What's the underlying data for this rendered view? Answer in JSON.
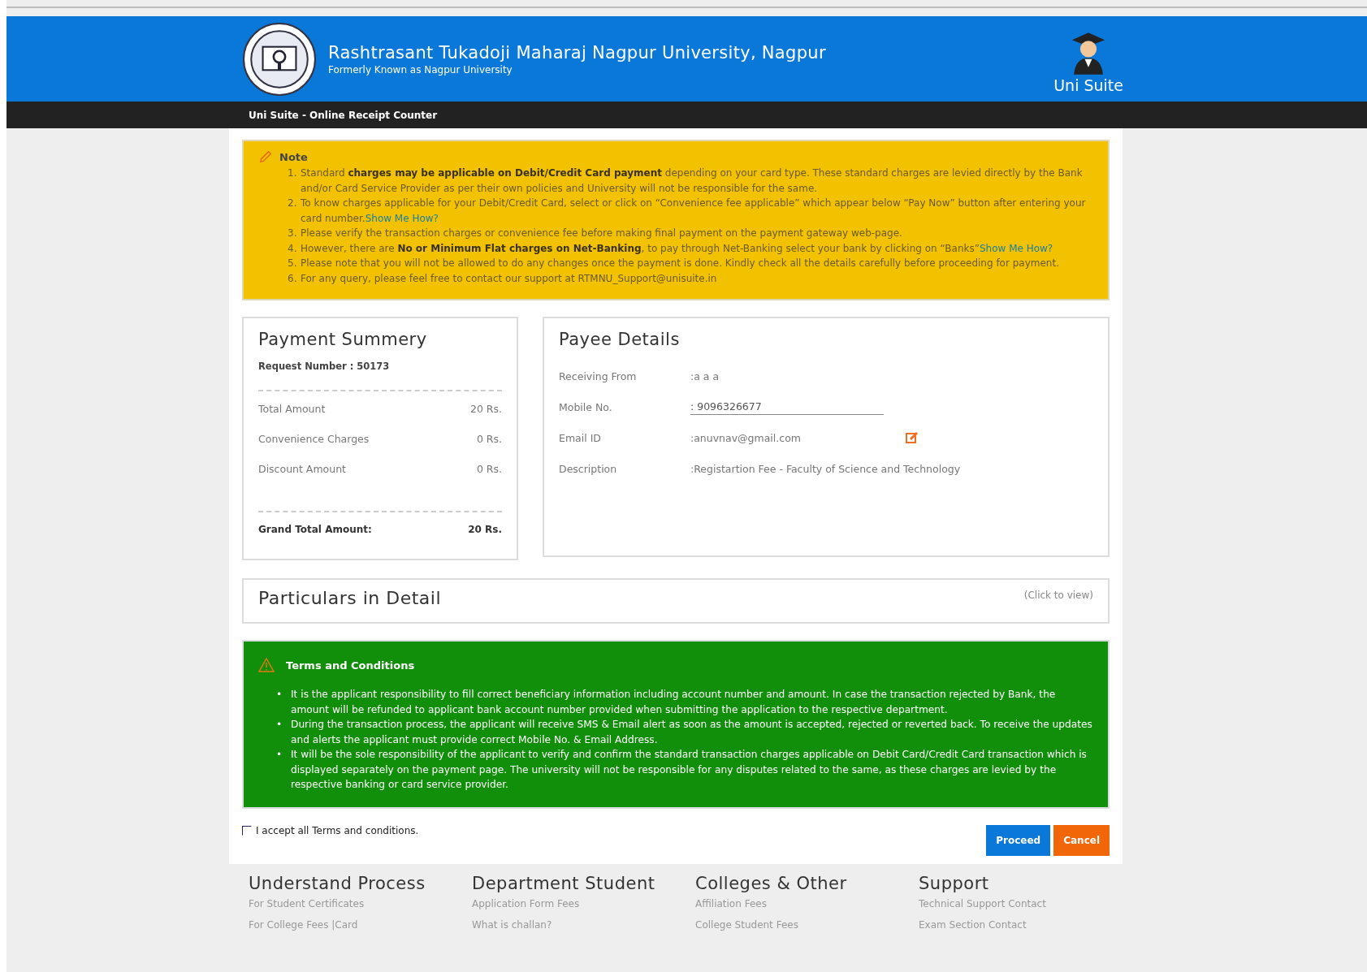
{
  "header": {
    "title": "Rashtrasant Tukadoji Maharaj Nagpur University, Nagpur",
    "subtitle": "Formerly Known as Nagpur University",
    "brand": "Uni Suite"
  },
  "breadcrumb": "Uni Suite - Online Receipt Counter",
  "note": {
    "title": "Note",
    "items": [
      {
        "number": "1.",
        "text": "Standard **charges may be applicable on Debit/Credit Card payment** depending on your card type. These standard charges are levied directly by the Bank and/or Card Service Provider as per their own policies and University will not be responsible for the same."
      },
      {
        "number": "2.",
        "text": "To know charges applicable for your Debit/Credit Card, select or click on “Convenience fee applicable” which appear below “Pay Now” button after entering your card number.",
        "link": "Show Me How?"
      },
      {
        "number": "3.",
        "text": "Please verify the transaction charges or convenience fee before making final payment on the payment gateway web-page."
      },
      {
        "number": "4.",
        "text": "However, there are **No or Minimum Flat charges on Net-Banking**, to pay through Net-Banking select your bank by clicking on “Banks”",
        "link": "Show Me How?"
      },
      {
        "number": "5.",
        "text": "Please note that you will not be allowed to do any changes once the payment is done. Kindly check all the details carefully before proceeding for payment."
      },
      {
        "number": "6.",
        "text": "For any query, please feel free to contact our support at RTMNU_Support@unisuite.in"
      }
    ]
  },
  "payment_summary": {
    "title": "Payment Summery",
    "request_number": "Request Number : 50173",
    "rows": [
      {
        "label": "Total Amount",
        "value": "20 Rs."
      },
      {
        "label": "Convenience Charges",
        "value": "0 Rs."
      },
      {
        "label": "Discount Amount",
        "value": "0 Rs."
      }
    ],
    "grand_total": {
      "label": "Grand Total Amount:",
      "value": "20 Rs."
    }
  },
  "payee_details": {
    "title": "Payee Details",
    "rows": [
      {
        "kind": "text",
        "label": "Receiving From",
        "value": ":a a a"
      },
      {
        "kind": "field",
        "label": "Mobile No.",
        "value": ": 9096326677"
      },
      {
        "kind": "editable",
        "label": "Email ID",
        "value": ":anuvnav@gmail.com"
      },
      {
        "kind": "text",
        "label": "Description",
        "value": ":Registartion Fee - Faculty of Science and Technology"
      }
    ]
  },
  "particulars": {
    "title": "Particulars in Detail",
    "hint": "(Click to view)"
  },
  "terms": {
    "title": "Terms and Conditions",
    "marker": "•",
    "items": [
      "It is the applicant responsibility to fill correct beneficiary information including account number and amount. In case the transaction rejected by Bank, the amount will be refunded to applicant bank account number provided when submitting the application to the respective department.",
      "During the transaction process, the applicant will receive SMS & Email alert as soon as the amount is accepted, rejected or reverted back. To receive the updates and alerts the applicant must provide correct Mobile No. & Email Address.",
      "It will be the sole responsibility of the applicant to verify and confirm the standard transaction charges applicable on Debit Card/Credit Card transaction which is displayed separately on the payment page. The university will not be responsible for any disputes related to the same, as these charges are levied by the respective banking or card service provider."
    ]
  },
  "accept": {
    "label": "I accept all Terms and conditions.",
    "checked": false
  },
  "buttons": [
    {
      "kind": "primary",
      "label": "Proceed"
    },
    {
      "kind": "danger",
      "label": "Cancel"
    }
  ],
  "footer": [
    {
      "title": "Understand Process",
      "links": [
        "For Student Certificates",
        "For College Fees |Card"
      ]
    },
    {
      "title": "Department Student",
      "links": [
        "Application Form Fees",
        "What is challan?"
      ]
    },
    {
      "title": "Colleges & Other",
      "links": [
        "Affiliation Fees",
        "College Student Fees"
      ]
    },
    {
      "title": "Support",
      "links": [
        "Technical Support Contact",
        "Exam Section Contact"
      ]
    }
  ]
}
